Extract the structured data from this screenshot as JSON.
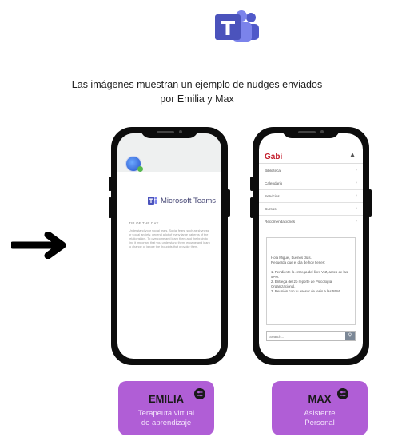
{
  "caption": {
    "line1": "Las imágenes muestran un ejemplo de nudges enviados",
    "line2": "por Emilia y Max"
  },
  "emilia_phone": {
    "app_name": "Microsoft Teams",
    "tip_title": "TIP OF THE DAY",
    "tip_body": "Understand your social fears. Social fears, such as shyness or social anxiety, depend a lot of many large patterns of the relationships. To overcome and learn them and the brain to find it important that you understand them, engage and learn to change or ignore the thoughts that provoke them."
  },
  "max_phone": {
    "title": "Gabi",
    "menu": [
      {
        "label": "Biblioteca"
      },
      {
        "label": "Calendario"
      },
      {
        "label": "Servicios"
      },
      {
        "label": "Cursos"
      },
      {
        "label": "Recomendaciones"
      }
    ],
    "message": {
      "greeting": "Hola Miguel,  buenos días.",
      "intro": "Recuerda que el día de hoy tienes:",
      "item1": "1. Pendiente la entrega del libro VIZ, antes de las 5PM.",
      "item2": "2. Entrega del 2o reporte de Psicología Organizacional.",
      "item3": "3. Reunión con tu asesor de tesis a las 5PM."
    },
    "search_placeholder": "Search..."
  },
  "badges": {
    "emilia": {
      "name": "EMILIA",
      "line1": "Terapeuta virtual",
      "line2": "de aprendizaje"
    },
    "max": {
      "name": "MAX",
      "line1": "Asistente",
      "line2": "Personal"
    }
  },
  "colors": {
    "teams_purple": "#5059c9",
    "badge_purple": "#b05ed6",
    "gabi_red": "#c4202e"
  },
  "icons": [
    "teams-logo-icon",
    "arrow-right-icon",
    "search-icon",
    "settings-icon"
  ]
}
